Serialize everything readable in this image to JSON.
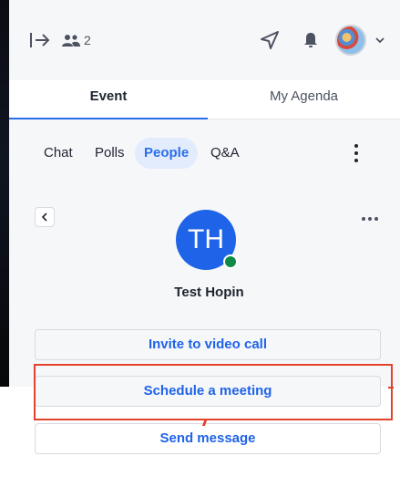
{
  "topbar": {
    "people_count": "2",
    "icons": [
      "exit-icon",
      "people-icon",
      "send-icon",
      "bell-icon",
      "chevron-down-icon"
    ]
  },
  "main_tabs": [
    {
      "label": "Event",
      "active": true
    },
    {
      "label": "My Agenda",
      "active": false
    }
  ],
  "sub_tabs": [
    {
      "label": "Chat",
      "active": false
    },
    {
      "label": "Polls",
      "active": false
    },
    {
      "label": "People",
      "active": true
    },
    {
      "label": "Q&A",
      "active": false
    }
  ],
  "profile": {
    "initials": "TH",
    "name": "Test Hopin",
    "status": "online"
  },
  "actions": {
    "invite": "Invite to video call",
    "schedule": "Schedule a meeting",
    "message": "Send message"
  },
  "colors": {
    "accent": "#1f63e8",
    "online": "#0e8a47",
    "highlight": "#e4432b"
  }
}
